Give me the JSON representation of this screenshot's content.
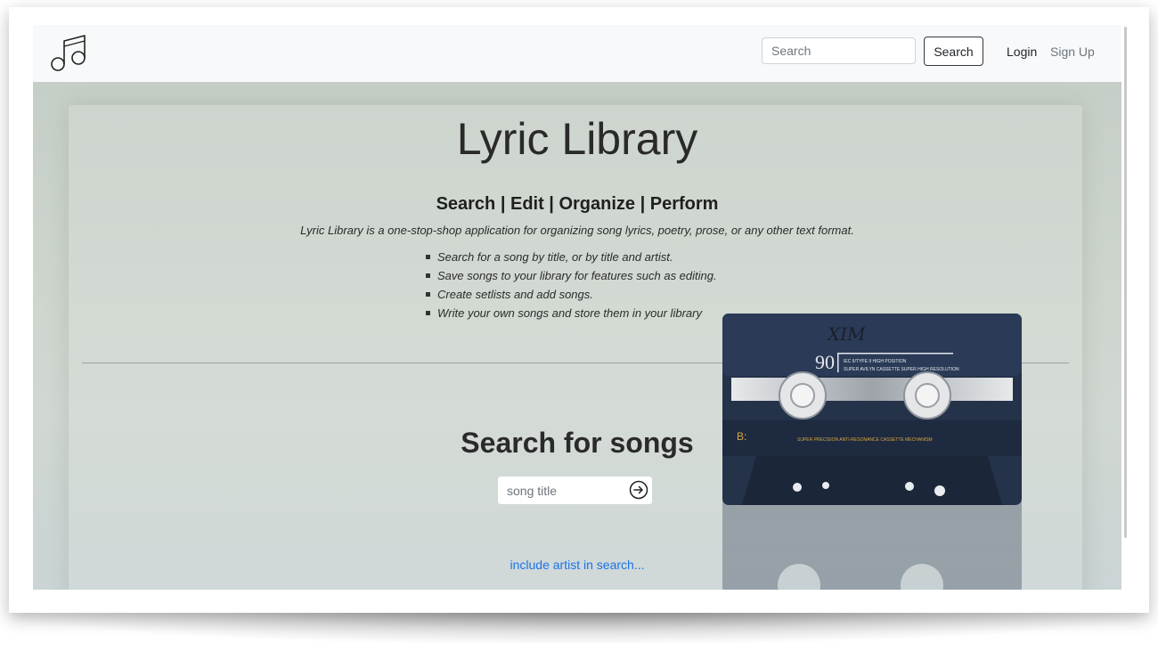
{
  "navbar": {
    "logo_icon": "music-note-icon",
    "search": {
      "placeholder": "Search",
      "button_label": "Search"
    },
    "login_label": "Login",
    "signup_label": "Sign Up"
  },
  "hero": {
    "title": "Lyric Library",
    "subtitle": "Search | Edit | Organize | Perform",
    "description": "Lyric Library is a one-stop-shop application for organizing song lyrics, poetry, prose, or any other text format.",
    "features": [
      "Search for a song by title, or by title and artist.",
      "Save songs to your library for features such as editing.",
      "Create setlists and add songs.",
      "Write your own songs and store them in your library"
    ],
    "background_image": "cassette-tape-image",
    "cassette": {
      "handwriting": "XIM",
      "length": "90",
      "label_line1": "IEC II/TYPE II HIGH POSITION",
      "label_line2": "SUPER AVILYN CASSETTE SUPER HIGH RESOLUTION",
      "side": "B:",
      "mechanism": "SUPER PRECISION ANTI-RESONANCE CASSETTE MECHANISM"
    }
  },
  "song_search": {
    "heading": "Search for songs",
    "placeholder": "song title",
    "submit_icon": "arrow-right-circle-icon",
    "artist_link": "include artist in search..."
  },
  "colors": {
    "link": "#1a73e8",
    "navbar_bg": "#f8f9fa",
    "hero_bg": "#cdd5cd"
  }
}
